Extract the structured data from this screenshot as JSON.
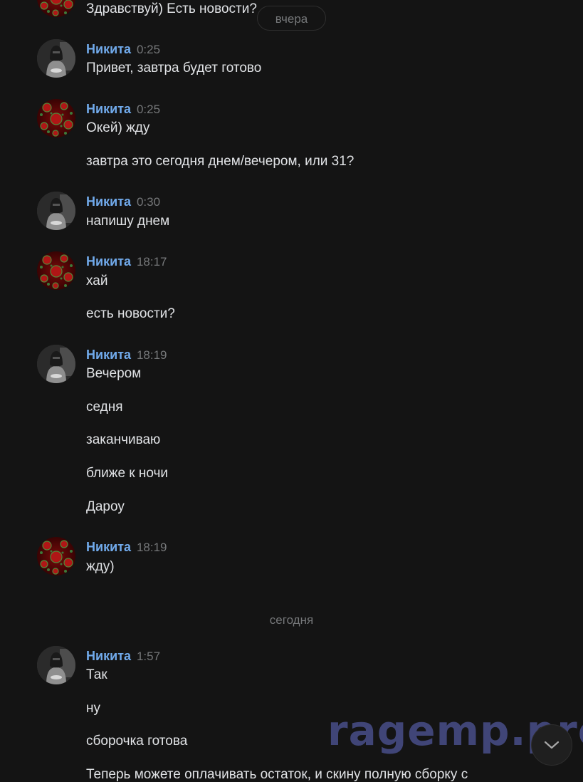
{
  "top_partial": {
    "text": "Здравствуй) Есть новости?"
  },
  "date_pill": "вчера",
  "date_separator": "сегодня",
  "messages": [
    {
      "author": "Никита",
      "time": "0:25",
      "avatar_icon": "hooded-figure-avatar",
      "lines": [
        "Привет, завтра будет готово"
      ]
    },
    {
      "author": "Никита",
      "time": "0:25",
      "avatar_icon": "virus-pattern-avatar",
      "lines": [
        "Окей) жду",
        "завтра это сегодня днем/вечером, или 31?"
      ]
    },
    {
      "author": "Никита",
      "time": "0:30",
      "avatar_icon": "hooded-figure-avatar",
      "lines": [
        "напишу днем"
      ]
    },
    {
      "author": "Никита",
      "time": "18:17",
      "avatar_icon": "virus-pattern-avatar",
      "lines": [
        "хай",
        "есть новости?"
      ]
    },
    {
      "author": "Никита",
      "time": "18:19",
      "avatar_icon": "hooded-figure-avatar",
      "lines": [
        "Вечером",
        "седня",
        "заканчиваю",
        "ближе к ночи",
        "Дароу"
      ]
    },
    {
      "author": "Никита",
      "time": "18:19",
      "avatar_icon": "virus-pattern-avatar",
      "lines": [
        "жду)"
      ]
    },
    {
      "author": "Никита",
      "time": "1:57",
      "avatar_icon": "hooded-figure-avatar",
      "lines": [
        "Так",
        "ну",
        "сборочка готова",
        "Теперь можете оплачивать остаток, и скину полную сборку с"
      ]
    }
  ],
  "watermark": "ragemp.pro",
  "scroll_button_icon": "chevron-down-icon",
  "colors": {
    "background": "#141414",
    "author": "#71aaeb",
    "text": "#e1e3e6",
    "muted": "#76787a"
  }
}
